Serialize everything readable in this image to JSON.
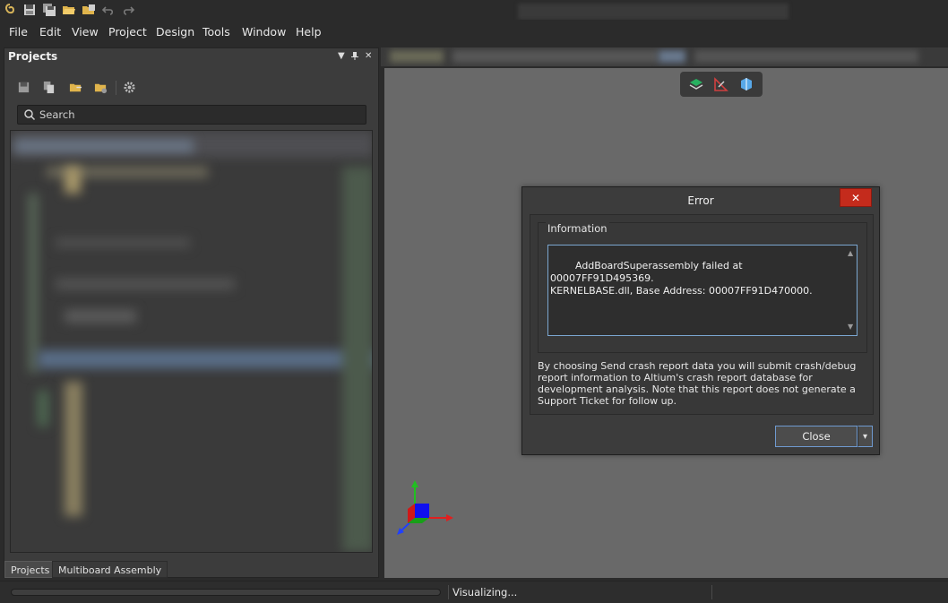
{
  "menu": {
    "items": [
      "File",
      "Edit",
      "View",
      "Project",
      "Design",
      "Tools",
      "Window",
      "Help"
    ]
  },
  "projects_panel": {
    "title": "Projects",
    "header_controls": {
      "menu": "▼",
      "pin": "📌",
      "close": "✕"
    },
    "search_placeholder": "Search",
    "tabs": [
      "Projects",
      "Multiboard Assembly"
    ]
  },
  "dialog": {
    "title": "Error",
    "close_glyph": "✕",
    "group_label": "Information",
    "message": "AddBoardSuperassembly failed at 00007FF91D495369.\nKERNELBASE.dll, Base Address: 00007FF91D470000.",
    "notice": "By choosing Send crash report data you will submit crash/debug report information to Altium's crash report database for development analysis. Note that this report does not generate a Support Ticket for follow up.",
    "close_button": "Close",
    "dropdown_glyph": "▾"
  },
  "statusbar": {
    "status_text": "Visualizing...",
    "progress": 0
  },
  "colors": {
    "accent": "#6f9ad0",
    "close_red": "#c42b1c",
    "axis_x": "#e02020",
    "axis_y": "#20c020",
    "axis_z": "#2040ff"
  }
}
